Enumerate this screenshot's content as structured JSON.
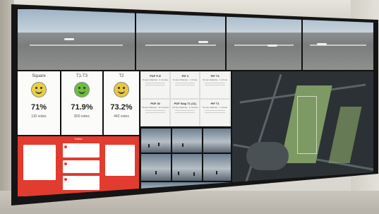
{
  "polls": [
    {
      "name": "Square",
      "percent": "71%",
      "votes": "110 votes",
      "color": "#e8d040"
    },
    {
      "name": "T1-T3",
      "percent": "71.9%",
      "votes": "820 votes",
      "color": "#6bbf3a"
    },
    {
      "name": "T2",
      "percent": "73.2%",
      "votes": "442 votes",
      "color": "#e8c640"
    }
  ],
  "feedback": {
    "header": "Twitter",
    "color": "#e23b2f"
  },
  "status_board": [
    {
      "title": "PDF P-E",
      "sub": "Temps d'attente : 3 minutes"
    },
    {
      "title": "PIF 3",
      "sub": "Temps d'attente : 1 minute"
    },
    {
      "title": "PIF T3",
      "sub": "Temps d'attente : 1 minute"
    },
    {
      "title": "PDF 30",
      "sub": "Temps d'attente : 11 minutes"
    },
    {
      "title": "PDF Skip T1 (11)",
      "sub": "Temps d'attente : 3 minutes"
    },
    {
      "title": "PIF T1",
      "sub": "Temps d'attente : 1 minute"
    }
  ]
}
